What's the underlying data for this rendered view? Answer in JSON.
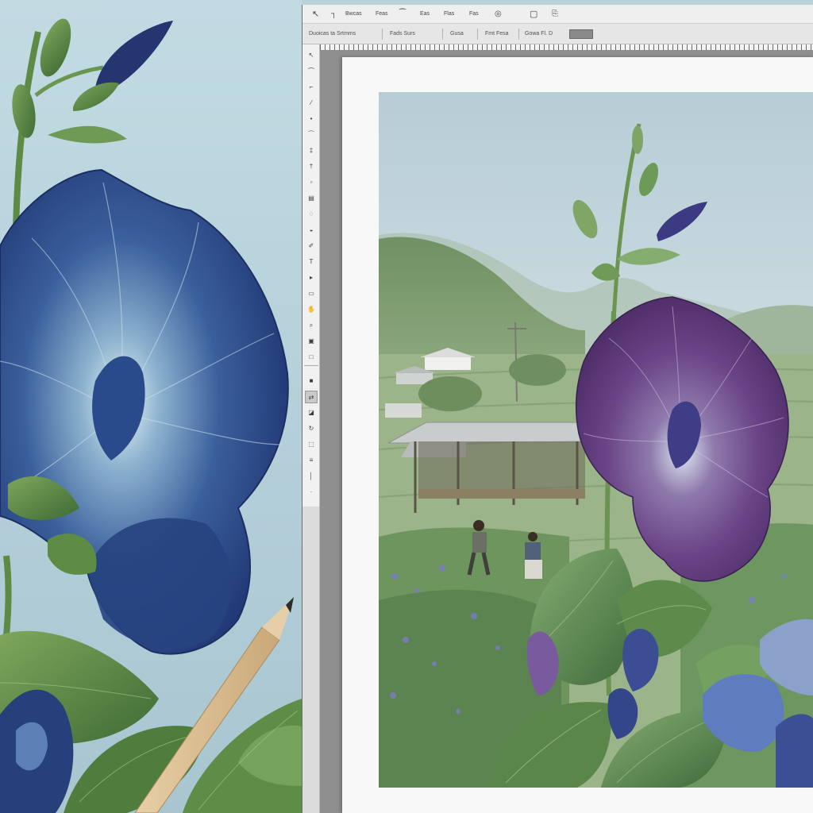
{
  "app": {
    "name": "image-editor",
    "menu": {
      "items": [
        {
          "icon": "move-tool-icon",
          "glyph": "↖"
        },
        {
          "icon": "pin-icon",
          "glyph": "┐"
        },
        {
          "label": "Bwcas"
        },
        {
          "label": "Feas"
        },
        {
          "icon": "brush-icon",
          "glyph": "⁀"
        },
        {
          "label": "Eas"
        },
        {
          "label": "Flas"
        },
        {
          "label": "Fas"
        },
        {
          "icon": "target-icon",
          "glyph": "◎"
        },
        {
          "icon": "frame-icon",
          "glyph": "▢"
        },
        {
          "icon": "document-icon",
          "glyph": "⎘"
        }
      ]
    },
    "options_bar": {
      "fields": [
        {
          "label": "Duoicas ta Srtmms"
        },
        {
          "label": "Fads Surs"
        },
        {
          "label": "Gusa"
        },
        {
          "label": "Fmt Fesa"
        },
        {
          "label": "Gowa Fl. D"
        }
      ],
      "swatch_color": "#8a8a8a"
    },
    "toolbox": {
      "tools": [
        {
          "icon": "pen-tool-icon",
          "glyph": "↖"
        },
        {
          "icon": "lasso-icon",
          "glyph": "⌒"
        },
        {
          "icon": "crop-icon",
          "glyph": "⌐"
        },
        {
          "icon": "eyedropper-icon",
          "glyph": "⁄"
        },
        {
          "icon": "heal-icon",
          "glyph": "•"
        },
        {
          "icon": "brush-tool-icon",
          "glyph": "⁀"
        },
        {
          "icon": "stamp-icon",
          "glyph": "‡"
        },
        {
          "icon": "history-brush-icon",
          "glyph": "†"
        },
        {
          "icon": "eraser-icon",
          "glyph": "▫"
        },
        {
          "icon": "gradient-icon",
          "glyph": "▤"
        },
        {
          "icon": "blur-icon",
          "glyph": "◌"
        },
        {
          "icon": "dodge-icon",
          "glyph": "◒"
        },
        {
          "icon": "pen-path-icon",
          "glyph": "✐"
        },
        {
          "icon": "type-icon",
          "glyph": "T"
        },
        {
          "icon": "path-select-icon",
          "glyph": "▸"
        },
        {
          "icon": "shape-icon",
          "glyph": "▭"
        },
        {
          "icon": "hand-icon",
          "glyph": "✋"
        },
        {
          "icon": "zoom-icon",
          "glyph": "⌕"
        },
        {
          "icon": "quick-mask-icon",
          "glyph": "▣"
        },
        {
          "icon": "screen-mode-icon",
          "glyph": "□"
        },
        {
          "icon": "foreground-color-icon",
          "glyph": "■"
        },
        {
          "icon": "swap-colors-icon",
          "glyph": "⇄"
        },
        {
          "icon": "default-colors-icon",
          "glyph": "◪"
        },
        {
          "icon": "rotate-view-icon",
          "glyph": "↻"
        },
        {
          "icon": "frame-tool-icon",
          "glyph": "⬚"
        },
        {
          "icon": "note-icon",
          "glyph": "≡"
        },
        {
          "icon": "ruler-icon",
          "glyph": "│"
        },
        {
          "icon": "count-icon",
          "glyph": "·"
        }
      ],
      "active_index": 21
    }
  },
  "palette": {
    "sky_left": "#bcd6df",
    "blue_petal": "#2a4a86",
    "purple_petal": "#5e3a7c",
    "leaf": "#5f8a45",
    "canvas_gray": "#8f8f8f"
  }
}
